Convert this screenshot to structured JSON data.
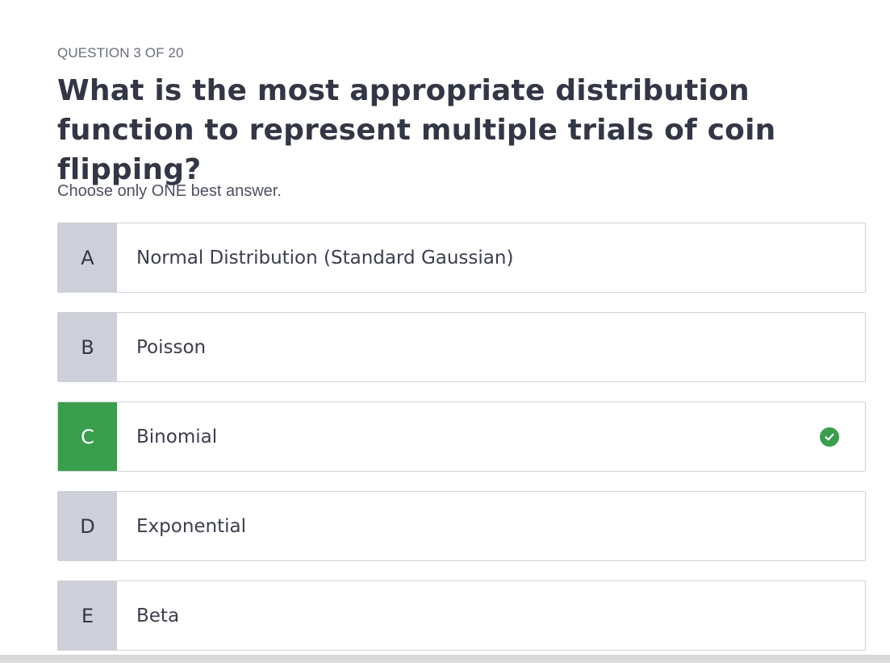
{
  "header": {
    "progress": "QUESTION 3 OF 20",
    "question": "What is the most appropriate distribution function to represent multiple trials of coin flipping?",
    "instruction": "Choose only ONE best answer."
  },
  "options": [
    {
      "letter": "A",
      "text": "Normal Distribution (Standard Gaussian)"
    },
    {
      "letter": "B",
      "text": "Poisson"
    },
    {
      "letter": "C",
      "text": "Binomial"
    },
    {
      "letter": "D",
      "text": "Exponential"
    },
    {
      "letter": "E",
      "text": "Beta"
    }
  ],
  "state": {
    "selected_option": "C",
    "correct_icon": "check-circle-icon"
  },
  "colors": {
    "correct": "#3a9e4d",
    "letter_bg": "#cdd0d8"
  }
}
